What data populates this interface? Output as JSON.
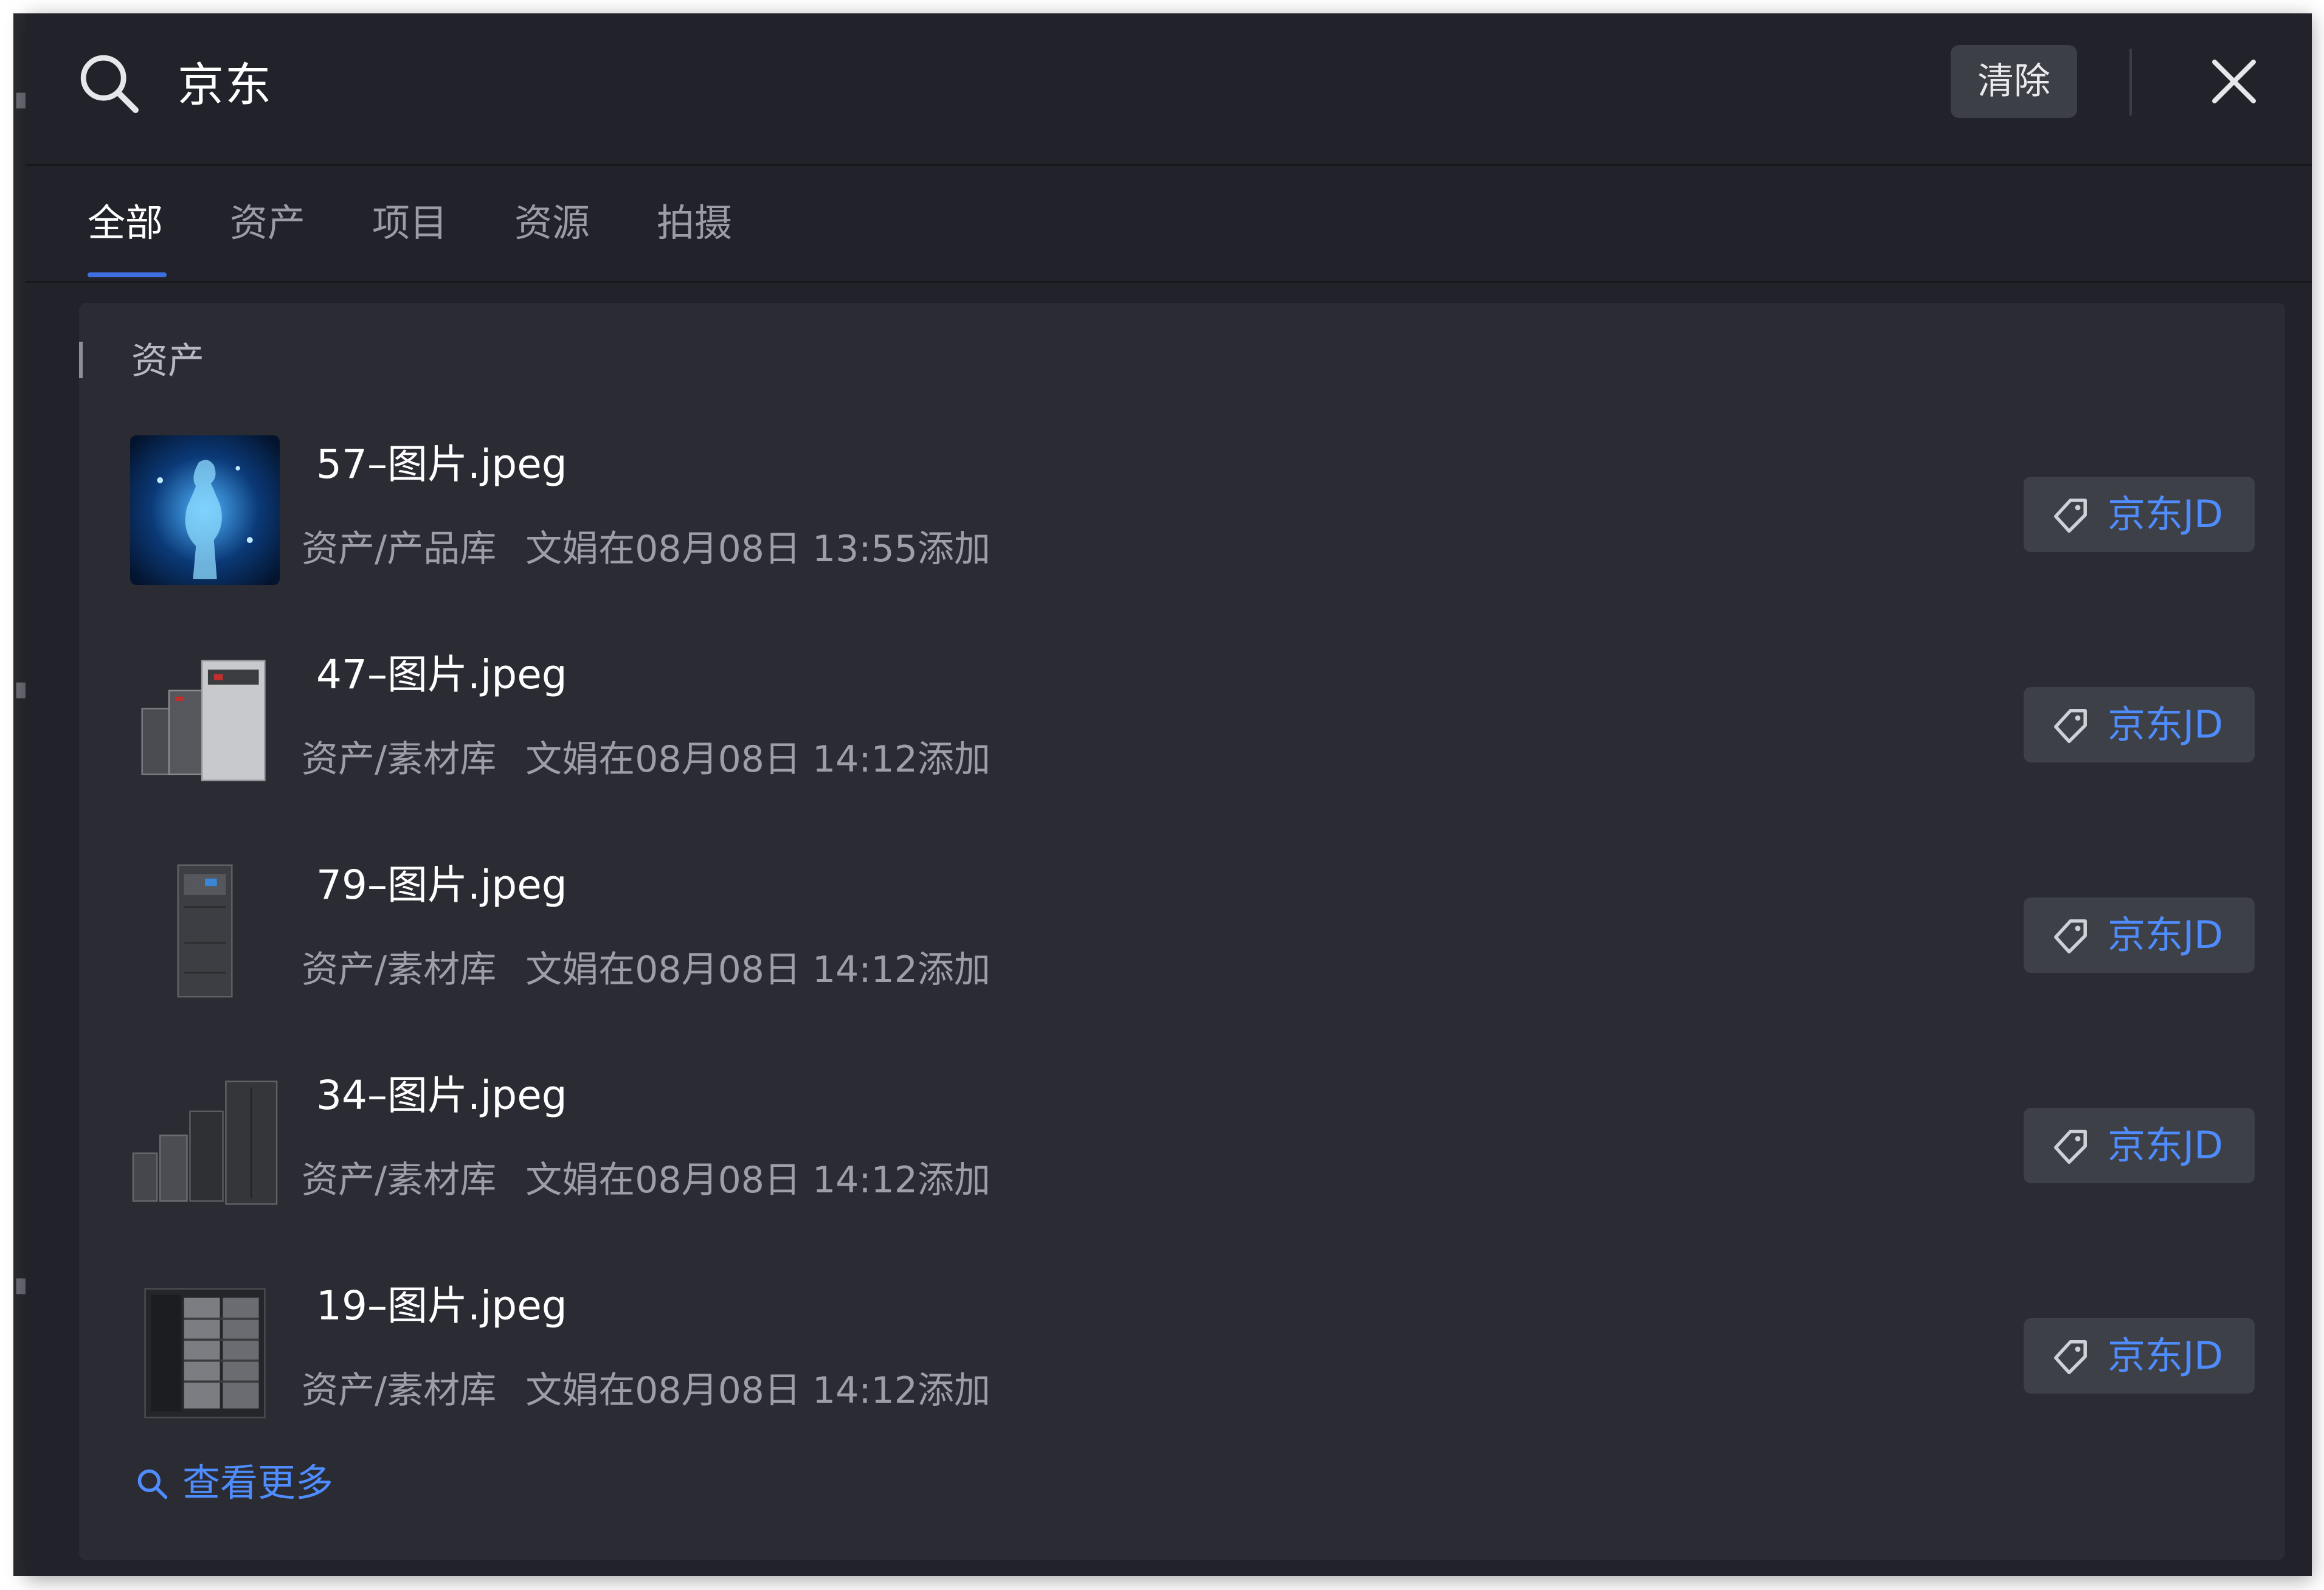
{
  "search": {
    "query": "京东",
    "clear_label": "清除"
  },
  "tabs": [
    {
      "label": "全部",
      "active": true
    },
    {
      "label": "资产",
      "active": false
    },
    {
      "label": "项目",
      "active": false
    },
    {
      "label": "资源",
      "active": false
    },
    {
      "label": "拍摄",
      "active": false
    }
  ],
  "section": {
    "title": "资产"
  },
  "results": [
    {
      "name": "57–图片.jpeg",
      "path": "资产/产品库",
      "added": "文娟在08月08日 13:55添加",
      "tag": "京东JD",
      "thumb": "dark-blue-digital-figure"
    },
    {
      "name": "47–图片.jpeg",
      "path": "资产/素材库",
      "added": "文娟在08月08日 14:12添加",
      "tag": "京东JD",
      "thumb": "ups-cabinets"
    },
    {
      "name": "79–图片.jpeg",
      "path": "资产/素材库",
      "added": "文娟在08月08日 14:12添加",
      "tag": "京东JD",
      "thumb": "single-cabinet"
    },
    {
      "name": "34–图片.jpeg",
      "path": "资产/素材库",
      "added": "文娟在08月08日 14:12添加",
      "tag": "京东JD",
      "thumb": "cabinet-row"
    },
    {
      "name": "19–图片.jpeg",
      "path": "资产/素材库",
      "added": "文娟在08月08日 14:12添加",
      "tag": "京东JD",
      "thumb": "open-rack-cabinet"
    }
  ],
  "see_more": {
    "label": "查看更多"
  },
  "colors": {
    "panel_bg": "#22232a",
    "card_bg": "#2a2b33",
    "accent": "#4f8dff",
    "tab_underline": "#3d6fe0",
    "tag_bg": "#3e4048"
  },
  "icons": {
    "search": "search-icon",
    "close": "close-icon",
    "tag": "tag-icon"
  }
}
